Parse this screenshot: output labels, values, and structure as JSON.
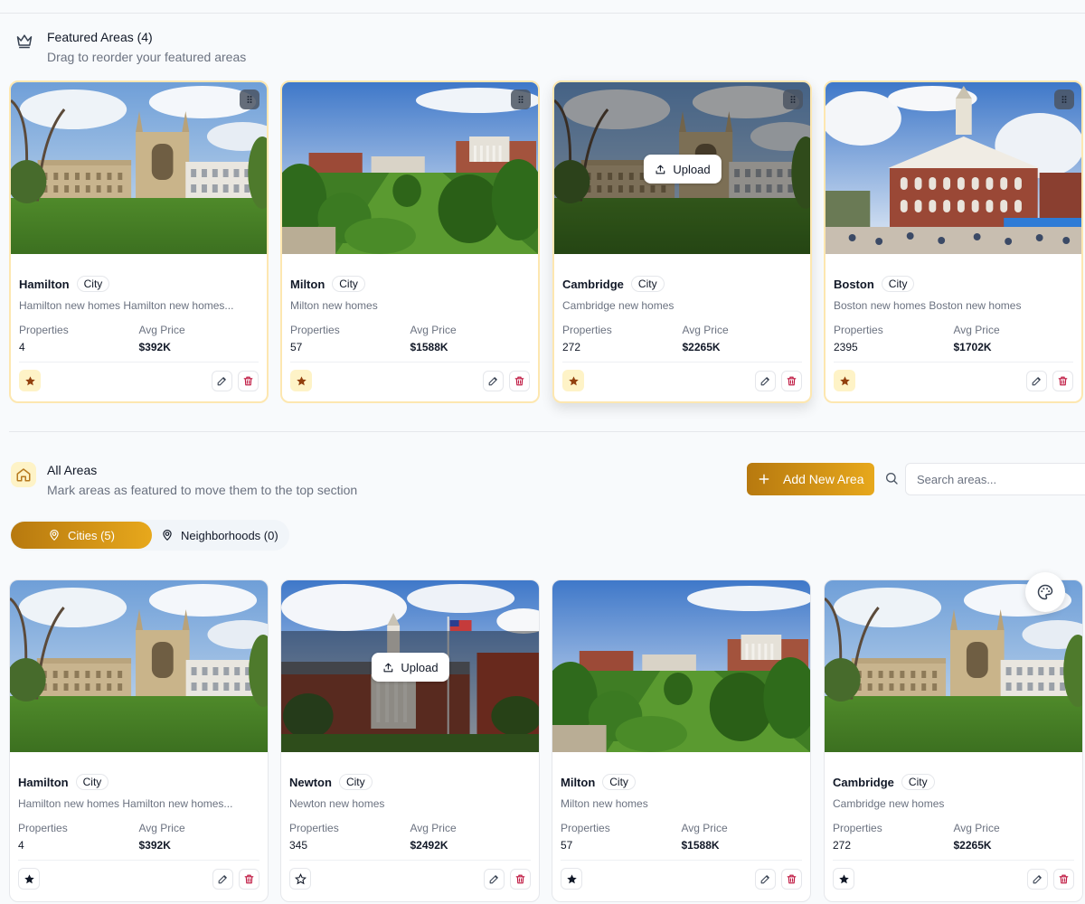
{
  "featured": {
    "title": "Featured Areas (4)",
    "subtitle": "Drag to reorder your featured areas",
    "cards": [
      {
        "name": "Hamilton",
        "type": "City",
        "desc": "Hamilton new homes Hamilton new homes...",
        "props_label": "Properties",
        "props": "4",
        "price_label": "Avg Price",
        "price": "$392K"
      },
      {
        "name": "Milton",
        "type": "City",
        "desc": "Milton new homes",
        "props_label": "Properties",
        "props": "57",
        "price_label": "Avg Price",
        "price": "$1588K"
      },
      {
        "name": "Cambridge",
        "type": "City",
        "desc": "Cambridge new homes",
        "props_label": "Properties",
        "props": "272",
        "price_label": "Avg Price",
        "price": "$2265K",
        "upload_label": "Upload"
      },
      {
        "name": "Boston",
        "type": "City",
        "desc": "Boston new homes Boston new homes",
        "props_label": "Properties",
        "props": "2395",
        "price_label": "Avg Price",
        "price": "$1702K"
      }
    ]
  },
  "all_areas": {
    "title": "All Areas",
    "subtitle": "Mark areas as featured to move them to the top section",
    "add_button": "Add New Area",
    "search_placeholder": "Search areas...",
    "tabs": [
      {
        "label": "Cities (5)"
      },
      {
        "label": "Neighborhoods (0)"
      }
    ],
    "cards": [
      {
        "name": "Hamilton",
        "type": "City",
        "desc": "Hamilton new homes Hamilton new homes...",
        "props_label": "Properties",
        "props": "4",
        "price_label": "Avg Price",
        "price": "$392K"
      },
      {
        "name": "Newton",
        "type": "City",
        "desc": "Newton new homes",
        "props_label": "Properties",
        "props": "345",
        "price_label": "Avg Price",
        "price": "$2492K",
        "upload_label": "Upload"
      },
      {
        "name": "Milton",
        "type": "City",
        "desc": "Milton new homes",
        "props_label": "Properties",
        "props": "57",
        "price_label": "Avg Price",
        "price": "$1588K"
      },
      {
        "name": "Cambridge",
        "type": "City",
        "desc": "Cambridge new homes",
        "props_label": "Properties",
        "props": "272",
        "price_label": "Avg Price",
        "price": "$2265K"
      }
    ]
  },
  "colors": {
    "accent": "#d4961a",
    "featured_border": "#fde7b0",
    "star_featured": "#92400e",
    "delete": "#be123c"
  }
}
